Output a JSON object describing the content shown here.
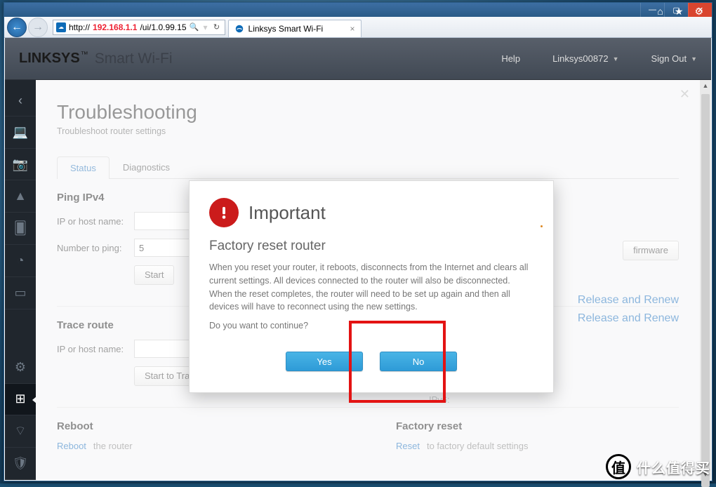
{
  "browser": {
    "url_prefix": "http://",
    "url_ip": "192.168.1.1",
    "url_suffix": "/ui/1.0.99.15",
    "tab_title": "Linksys Smart Wi-Fi"
  },
  "header": {
    "brand": "LINKSYS",
    "brand_sub": "Smart Wi-Fi",
    "help": "Help",
    "account": "Linksys00872",
    "signout": "Sign Out"
  },
  "page": {
    "title": "Troubleshooting",
    "subtitle": "Troubleshoot router settings",
    "tabs": {
      "status": "Status",
      "diagnostics": "Diagnostics"
    },
    "ping": {
      "title": "Ping IPv4",
      "ip_label": "IP or host name:",
      "ip_value": "",
      "num_label": "Number to ping:",
      "num_value": "5",
      "start": "Start"
    },
    "firmware_btn": "firmware",
    "ipv6_label": "IPv6:",
    "renew1": "Release and Renew",
    "renew2": "Release and Renew",
    "trace": {
      "title": "Trace route",
      "ip_label": "IP or host name:",
      "ip_value": "",
      "start": "Start to Traceroute"
    },
    "reboot": {
      "title": "Reboot",
      "link": "Reboot",
      "rest": " the router"
    },
    "factory": {
      "title": "Factory reset",
      "link": "Reset",
      "rest": " to factory default settings"
    }
  },
  "dialog": {
    "title": "Important",
    "subtitle": "Factory reset router",
    "body": "When you reset your router, it reboots, disconnects from the Internet and clears all current settings. All devices connected to the router will also be disconnected. When the reset completes, the router will need to be set up again and then all devices will have to reconnect using the new settings.",
    "question": "Do you want to continue?",
    "yes": "Yes",
    "no": "No"
  },
  "watermark": "什么值得买"
}
